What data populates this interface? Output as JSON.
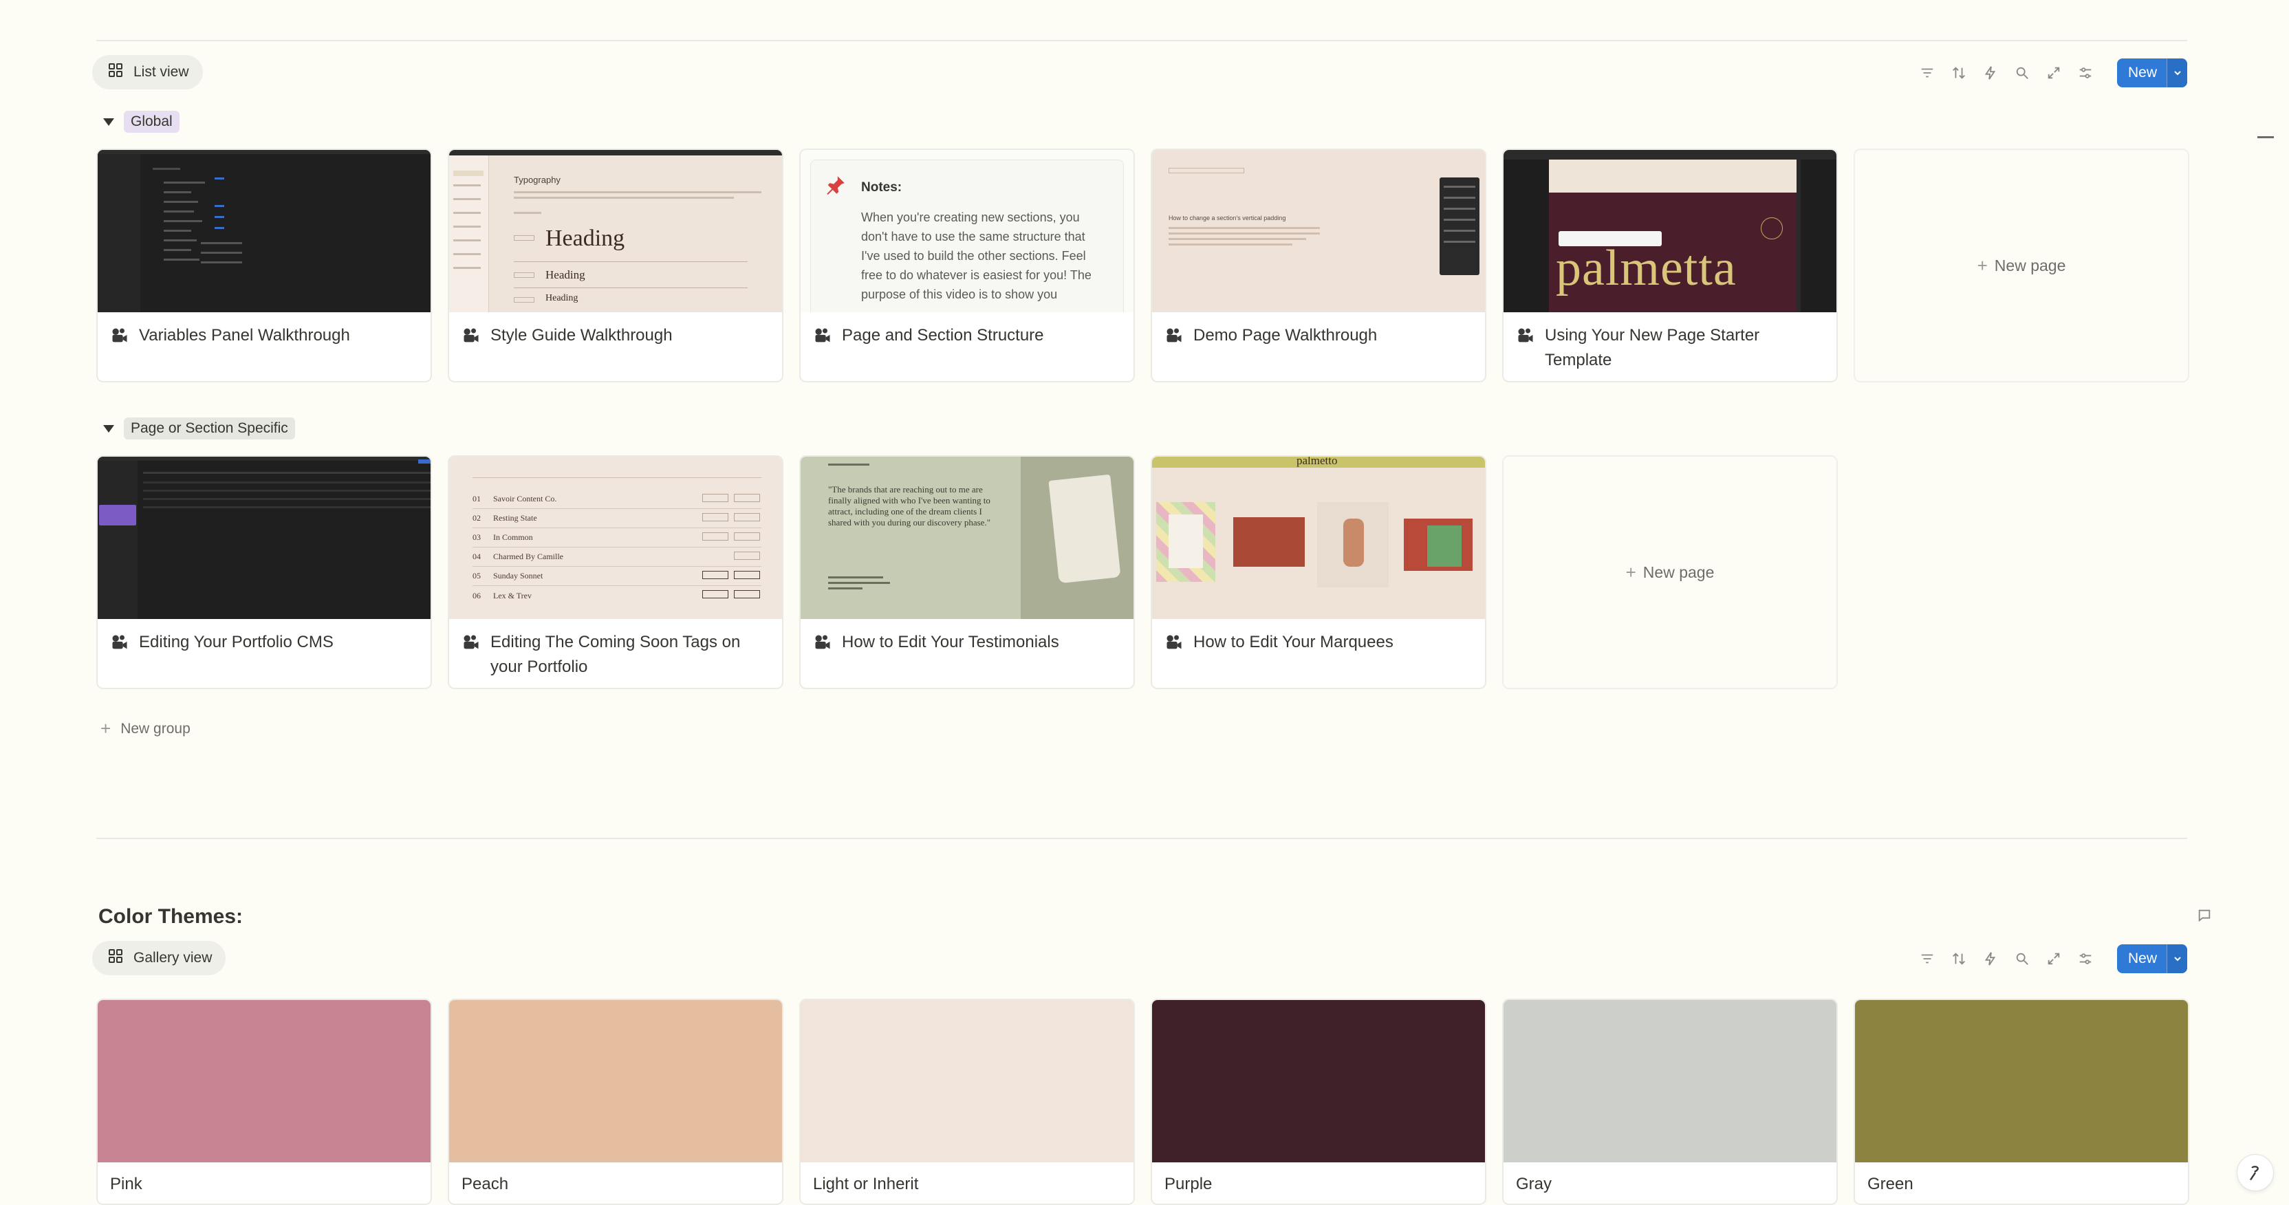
{
  "section1": {
    "view_label": "List view",
    "new_label": "New",
    "groups": [
      {
        "label": "Global",
        "tag_color": "#e8def2",
        "cards": [
          {
            "title": "Variables Panel Walkthrough"
          },
          {
            "title": "Style Guide Walkthrough",
            "thumb_title": "Typography",
            "thumb_headings": [
              "Heading",
              "Heading",
              "Heading"
            ]
          },
          {
            "title": "Page and Section Structure",
            "thumb_notes_title": "Notes:",
            "thumb_notes_text": "When you're creating new sections, you don't have to use the same structure that I've used to build the other sections. Feel free to do whatever is easiest for you! The purpose of this video is to show you"
          },
          {
            "title": "Demo Page Walkthrough",
            "thumb_text": "How to change a section's vertical padding"
          },
          {
            "title": "Using Your New Page Starter Template",
            "thumb_brand": "palmetta"
          }
        ],
        "new_page": "New page"
      },
      {
        "label": "Page or Section Specific",
        "tag_color": "#e7e7e2",
        "cards": [
          {
            "title": "Editing Your Portfolio CMS"
          },
          {
            "title": "Editing The Coming Soon Tags on your Portfolio",
            "thumb_list": [
              {
                "n": "01",
                "t": "Savoir Content Co."
              },
              {
                "n": "02",
                "t": "Resting State"
              },
              {
                "n": "03",
                "t": "In Common"
              },
              {
                "n": "04",
                "t": "Charmed By Camille"
              },
              {
                "n": "05",
                "t": "Sunday Sonnet"
              },
              {
                "n": "06",
                "t": "Lex & Trev"
              }
            ]
          },
          {
            "title": "How to Edit Your Testimonials",
            "thumb_quote": "\"The brands that are reaching out to me are finally aligned with who I've been wanting to attract, including one of the dream clients I shared with you during our discovery phase.\""
          },
          {
            "title": "How to Edit Your Marquees",
            "thumb_brand": "palmetto"
          }
        ],
        "new_page": "New page"
      }
    ],
    "new_group": "New group"
  },
  "section2": {
    "heading": "Color Themes:",
    "view_label": "Gallery view",
    "new_label": "New",
    "themes": [
      {
        "name": "Pink",
        "color": "#c98494"
      },
      {
        "name": "Peach",
        "color": "#e5bea0"
      },
      {
        "name": "Light or Inherit",
        "color": "#f0e4db"
      },
      {
        "name": "Purple",
        "color": "#3f1f28"
      },
      {
        "name": "Gray",
        "color": "#cdcfca"
      },
      {
        "name": "Green",
        "color": "#8d8340"
      }
    ]
  },
  "colors": {
    "accent": "#2f7ad7",
    "page_bg": "#fdfdf6"
  },
  "icons": [
    "gallery-icon",
    "filter-icon",
    "sort-icon",
    "lightning-icon",
    "search-icon",
    "expand-icon",
    "settings-icon",
    "chevron-down-icon",
    "movie-camera-icon",
    "plus-icon",
    "comment-icon",
    "help-icon"
  ]
}
